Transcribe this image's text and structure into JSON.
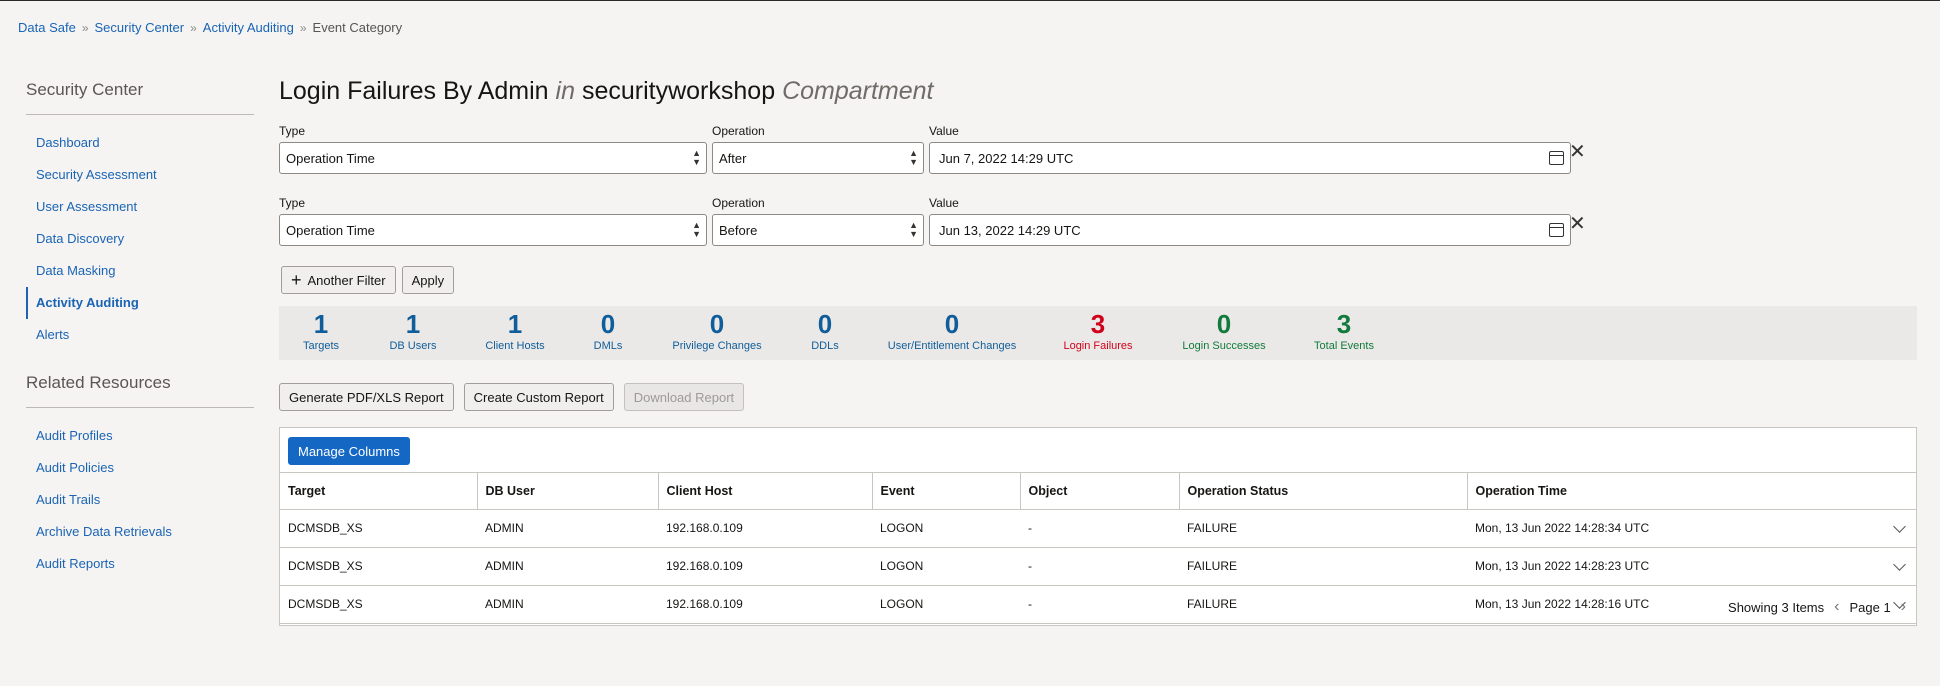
{
  "breadcrumb": [
    "Data Safe",
    "Security Center",
    "Activity Auditing",
    "Event Category"
  ],
  "sidebar": {
    "heading": "Security Center",
    "items": [
      {
        "label": "Dashboard"
      },
      {
        "label": "Security Assessment"
      },
      {
        "label": "User Assessment"
      },
      {
        "label": "Data Discovery"
      },
      {
        "label": "Data Masking"
      },
      {
        "label": "Activity Auditing",
        "active": true
      },
      {
        "label": "Alerts"
      }
    ],
    "related_heading": "Related Resources",
    "related_items": [
      {
        "label": "Audit Profiles"
      },
      {
        "label": "Audit Policies"
      },
      {
        "label": "Audit Trails"
      },
      {
        "label": "Archive Data Retrievals"
      },
      {
        "label": "Audit Reports"
      }
    ]
  },
  "title": {
    "main": "Login Failures By Admin",
    "in": "in",
    "compartment_name": "securityworkshop",
    "compartment": "Compartment"
  },
  "filters": [
    {
      "type_label": "Type",
      "type_value": "Operation Time",
      "op_label": "Operation",
      "op_value": "After",
      "value_label": "Value",
      "value": "Jun 7, 2022 14:29 UTC"
    },
    {
      "type_label": "Type",
      "type_value": "Operation Time",
      "op_label": "Operation",
      "op_value": "Before",
      "value_label": "Value",
      "value": "Jun 13, 2022 14:29 UTC"
    }
  ],
  "filter_buttons": {
    "another": "Another Filter",
    "apply": "Apply"
  },
  "stats": [
    {
      "num": "1",
      "label": "Targets",
      "color": "#0f5d9a"
    },
    {
      "num": "1",
      "label": "DB Users",
      "color": "#0f5d9a"
    },
    {
      "num": "1",
      "label": "Client Hosts",
      "color": "#0f5d9a"
    },
    {
      "num": "0",
      "label": "DMLs",
      "color": "#0f5d9a"
    },
    {
      "num": "0",
      "label": "Privilege Changes",
      "color": "#0f5d9a"
    },
    {
      "num": "0",
      "label": "DDLs",
      "color": "#0f5d9a"
    },
    {
      "num": "0",
      "label": "User/Entitlement Changes",
      "color": "#0f5d9a"
    },
    {
      "num": "3",
      "label": "Login Failures",
      "color": "#d0021b"
    },
    {
      "num": "0",
      "label": "Login Successes",
      "color": "#127a3c"
    },
    {
      "num": "3",
      "label": "Total Events",
      "color": "#127a3c"
    }
  ],
  "report_buttons": {
    "generate": "Generate PDF/XLS Report",
    "custom": "Create Custom Report",
    "download": "Download Report"
  },
  "table": {
    "manage_columns": "Manage Columns",
    "columns": [
      "Target",
      "DB User",
      "Client Host",
      "Event",
      "Object",
      "Operation Status",
      "Operation Time"
    ],
    "rows": [
      [
        "DCMSDB_XS",
        "ADMIN",
        "192.168.0.109",
        "LOGON",
        "-",
        "FAILURE",
        "Mon, 13 Jun 2022 14:28:34 UTC"
      ],
      [
        "DCMSDB_XS",
        "ADMIN",
        "192.168.0.109",
        "LOGON",
        "-",
        "FAILURE",
        "Mon, 13 Jun 2022 14:28:23 UTC"
      ],
      [
        "DCMSDB_XS",
        "ADMIN",
        "192.168.0.109",
        "LOGON",
        "-",
        "FAILURE",
        "Mon, 13 Jun 2022 14:28:16 UTC"
      ]
    ],
    "footer_showing": "Showing 3 Items",
    "footer_page": "Page 1"
  }
}
